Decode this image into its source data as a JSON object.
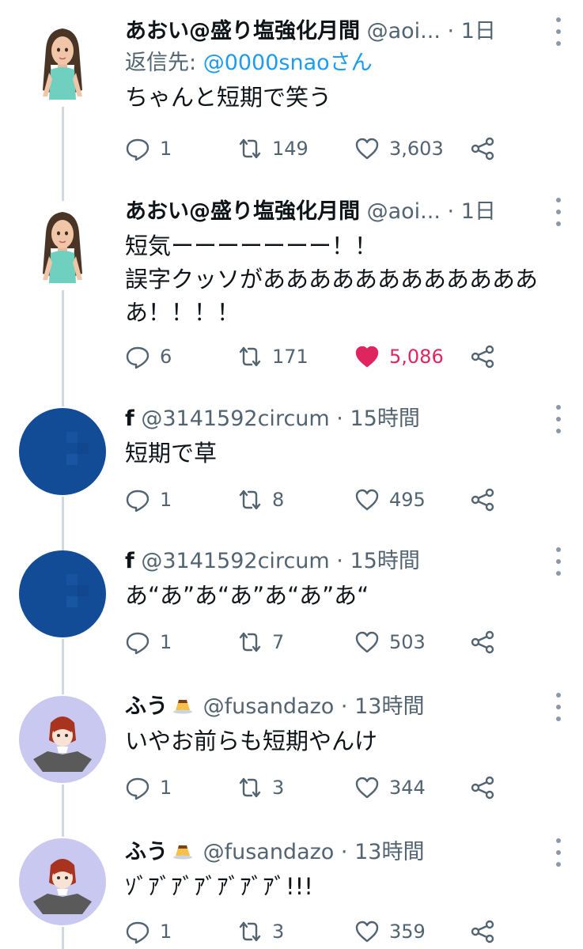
{
  "tweets": [
    {
      "name": "あおい@盛り塩強化月間",
      "handle": "@aoi...",
      "dot": "·",
      "time": "1日",
      "reply_prefix": "返信先:",
      "reply_mention": "@0000snaoさん",
      "text": "ちゃんと短期で笑う",
      "replies": "1",
      "retweets": "149",
      "likes": "3,603",
      "liked": false
    },
    {
      "name": "あおい@盛り塩強化月間",
      "handle": "@aoi...",
      "dot": "·",
      "time": "1日",
      "text": "短気ーーーーーーー！！\n誤字クッソがあああああああああああああ！！！！",
      "replies": "6",
      "retweets": "171",
      "likes": "5,086",
      "liked": true
    },
    {
      "name": "f",
      "handle": "@3141592circum",
      "dot": "·",
      "time": "15時間",
      "text": "短期で草",
      "replies": "1",
      "retweets": "8",
      "likes": "495",
      "liked": false
    },
    {
      "name": "f",
      "handle": "@3141592circum",
      "dot": "·",
      "time": "15時間",
      "text": "あ“あ”あ“あ”あ“あ”あ“",
      "replies": "1",
      "retweets": "7",
      "likes": "503",
      "liked": false
    },
    {
      "name": "ふう",
      "handle": "@fusandazo",
      "dot": "·",
      "time": "13時間",
      "text": "いやお前らも短期やんけ",
      "replies": "1",
      "retweets": "3",
      "likes": "344",
      "liked": false
    },
    {
      "name": "ふう",
      "handle": "@fusandazo",
      "dot": "·",
      "time": "13時間",
      "text": "ｿﾞｱﾞｱﾞｱﾞｱﾞｱﾞｱﾞ!!!",
      "replies": "1",
      "retweets": "3",
      "likes": "359",
      "liked": false
    }
  ],
  "colors": {
    "text": "#0f1419",
    "secondary": "#536471",
    "link": "#1d9bf0",
    "like_active": "#e0245e",
    "thread_line": "#cfd9de"
  },
  "icons": [
    "reply-icon",
    "retweet-icon",
    "like-icon",
    "share-icon",
    "more-icon",
    "pudding-icon"
  ]
}
